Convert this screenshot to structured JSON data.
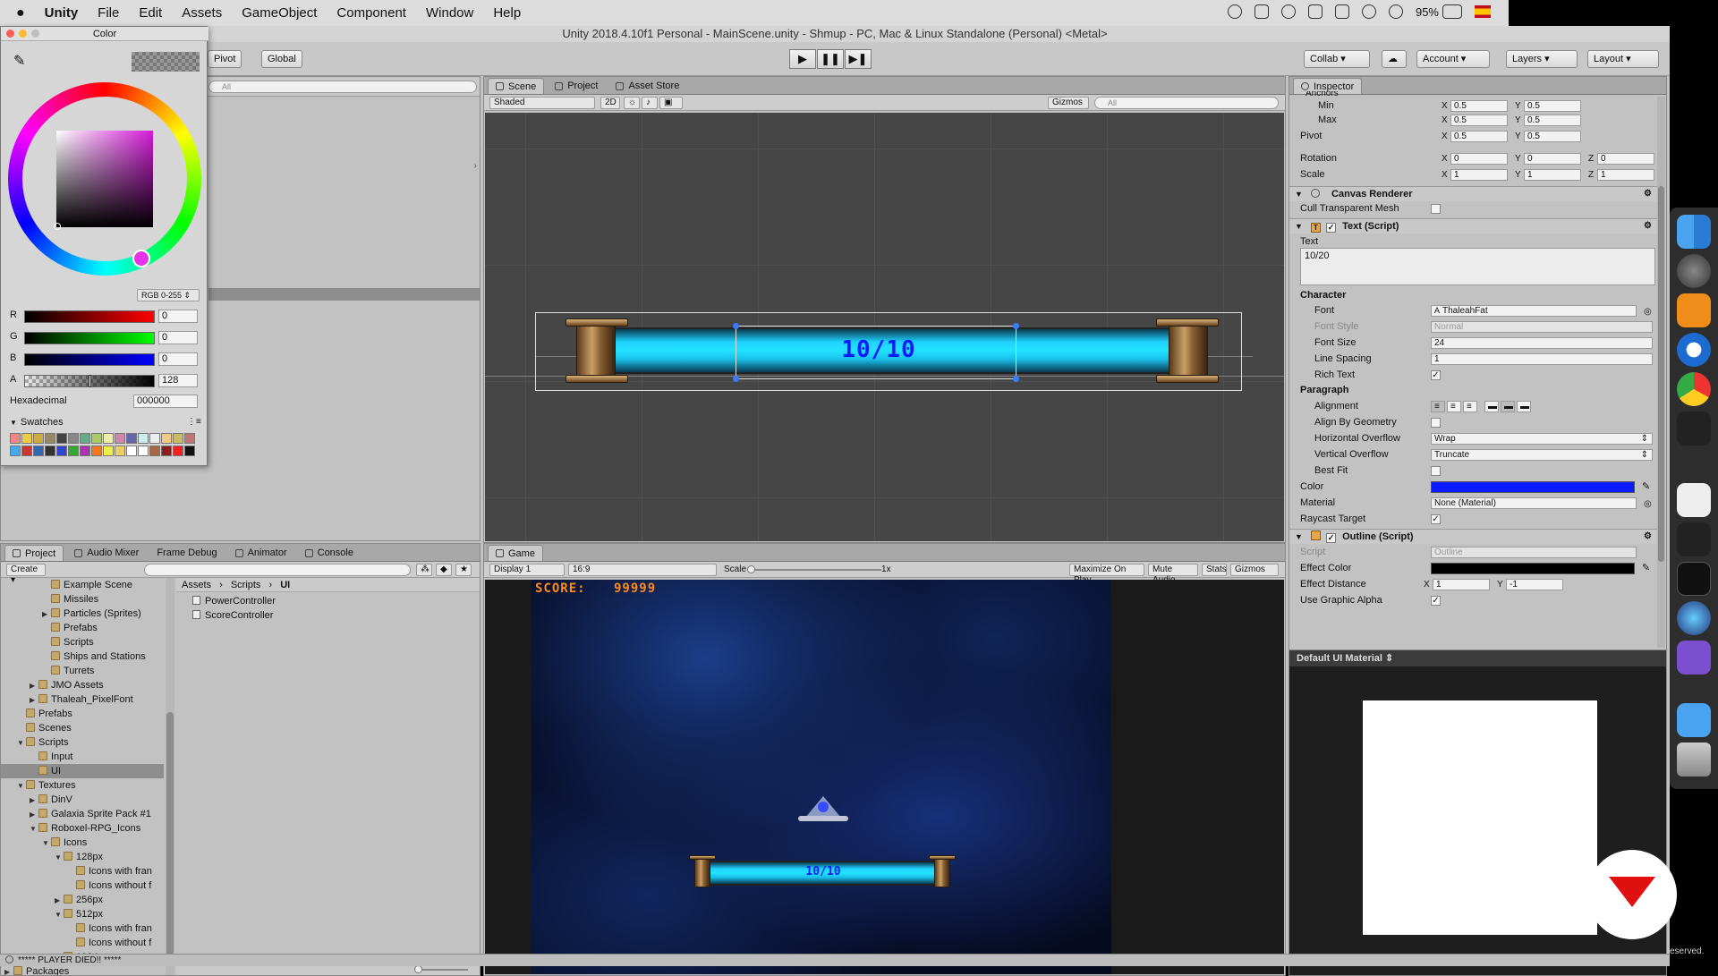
{
  "menubar": {
    "app": "Unity",
    "items": [
      "File",
      "Edit",
      "Assets",
      "GameObject",
      "Component",
      "Window",
      "Help"
    ],
    "battery": "95%"
  },
  "window_title": "Unity 2018.4.10f1 Personal - MainScene.unity - Shmup - PC, Mac & Linux Standalone (Personal) <Metal>",
  "toolbar": {
    "pivot": "Pivot",
    "global": "Global",
    "collab": "Collab",
    "account": "Account",
    "layers": "Layers",
    "layout": "Layout",
    "play": "▶",
    "pause": "❚❚",
    "step": "▶❚"
  },
  "color_picker": {
    "title": "Color",
    "mode": "RGB 0-255",
    "r_label": "R",
    "r": "0",
    "g_label": "G",
    "g": "0",
    "b_label": "B",
    "b": "0",
    "a_label": "A",
    "a": "128",
    "hex_label": "Hexadecimal",
    "hex": "000000",
    "swatches_label": "Swatches",
    "swatches": [
      "#e88",
      "#ec4",
      "#ca4",
      "#986",
      "#444",
      "#888",
      "#6a8",
      "#ac6",
      "#eea",
      "#c8a",
      "#66a",
      "#cee",
      "#eee",
      "#ec8",
      "#cb6",
      "#b77",
      "#4ae",
      "#c33",
      "#36a",
      "#333",
      "#34c",
      "#3a3",
      "#a3a",
      "#e72",
      "#ee4",
      "#ec6",
      "#fff",
      "#fff",
      "#a64",
      "#822",
      "#e22",
      "#111"
    ]
  },
  "hierarchy": {
    "search_placeholder": "All"
  },
  "scene": {
    "tabs": [
      "Scene",
      "Project",
      "Asset Store"
    ],
    "shading": "Shaded",
    "mode2d": "2D",
    "gizmos": "Gizmos",
    "search_placeholder": "All",
    "bar_text": "10/10"
  },
  "project": {
    "tabs": [
      "Project",
      "Audio Mixer",
      "Frame Debug",
      "Animator",
      "Console"
    ],
    "create": "Create",
    "tree": [
      {
        "label": "Example Scene",
        "indent": 3,
        "arrow": ""
      },
      {
        "label": "Missiles",
        "indent": 3,
        "arrow": ""
      },
      {
        "label": "Particles (Sprites)",
        "indent": 3,
        "arrow": "▶"
      },
      {
        "label": "Prefabs",
        "indent": 3,
        "arrow": ""
      },
      {
        "label": "Scripts",
        "indent": 3,
        "arrow": ""
      },
      {
        "label": "Ships and Stations",
        "indent": 3,
        "arrow": ""
      },
      {
        "label": "Turrets",
        "indent": 3,
        "arrow": ""
      },
      {
        "label": "JMO Assets",
        "indent": 2,
        "arrow": "▶"
      },
      {
        "label": "Thaleah_PixelFont",
        "indent": 2,
        "arrow": "▶"
      },
      {
        "label": "Prefabs",
        "indent": 1,
        "arrow": ""
      },
      {
        "label": "Scenes",
        "indent": 1,
        "arrow": ""
      },
      {
        "label": "Scripts",
        "indent": 1,
        "arrow": "▼"
      },
      {
        "label": "Input",
        "indent": 2,
        "arrow": ""
      },
      {
        "label": "UI",
        "indent": 2,
        "arrow": "",
        "selected": true
      },
      {
        "label": "Textures",
        "indent": 1,
        "arrow": "▼"
      },
      {
        "label": "DinV",
        "indent": 2,
        "arrow": "▶"
      },
      {
        "label": "Galaxia Sprite Pack #1",
        "indent": 2,
        "arrow": "▶"
      },
      {
        "label": "Roboxel-RPG_Icons",
        "indent": 2,
        "arrow": "▼"
      },
      {
        "label": "Icons",
        "indent": 3,
        "arrow": "▼"
      },
      {
        "label": "128px",
        "indent": 4,
        "arrow": "▼"
      },
      {
        "label": "Icons with fran",
        "indent": 5,
        "arrow": ""
      },
      {
        "label": "Icons without f",
        "indent": 5,
        "arrow": ""
      },
      {
        "label": "256px",
        "indent": 4,
        "arrow": "▶"
      },
      {
        "label": "512px",
        "indent": 4,
        "arrow": "▼"
      },
      {
        "label": "Icons with fran",
        "indent": 5,
        "arrow": ""
      },
      {
        "label": "Icons without f",
        "indent": 5,
        "arrow": ""
      },
      {
        "label": "1024px",
        "indent": 4,
        "arrow": "▶"
      },
      {
        "label": "Packages",
        "indent": 0,
        "arrow": "▶"
      }
    ],
    "breadcrumb": [
      "Assets",
      "Scripts",
      "UI"
    ],
    "files": [
      "PowerController",
      "ScoreController"
    ]
  },
  "game": {
    "tab": "Game",
    "display": "Display 1",
    "aspect": "16:9",
    "scale_label": "Scale",
    "scale_value": "1x",
    "maximize": "Maximize On Play",
    "mute": "Mute Audio",
    "stats": "Stats",
    "gizmos": "Gizmos",
    "score_label": "SCORE:",
    "score_value": "99999",
    "bar_text": "10/10"
  },
  "inspector": {
    "tab": "Inspector",
    "anchors_label": "Anchors",
    "min_label": "Min",
    "min_x": "0.5",
    "min_y": "0.5",
    "max_label": "Max",
    "max_x": "0.5",
    "max_y": "0.5",
    "pivot_label": "Pivot",
    "pivot_x": "0.5",
    "pivot_y": "0.5",
    "rotation_label": "Rotation",
    "rot_x": "0",
    "rot_y": "0",
    "rot_z": "0",
    "scale_label": "Scale",
    "scale_x": "1",
    "scale_y": "1",
    "scale_z": "1",
    "x": "X",
    "y": "Y",
    "z": "Z",
    "canvas_renderer": "Canvas Renderer",
    "cull_label": "Cull Transparent Mesh",
    "text_script": "Text (Script)",
    "text_label": "Text",
    "text_value": "10/20",
    "character_label": "Character",
    "font_label": "Font",
    "font_value": "ThaleahFat",
    "fontstyle_label": "Font Style",
    "fontstyle_value": "Normal",
    "fontsize_label": "Font Size",
    "fontsize_value": "24",
    "linespacing_label": "Line Spacing",
    "linespacing_value": "1",
    "richtext_label": "Rich Text",
    "paragraph_label": "Paragraph",
    "alignment_label": "Alignment",
    "alignbygeo_label": "Align By Geometry",
    "hoverflow_label": "Horizontal Overflow",
    "hoverflow_value": "Wrap",
    "voverflow_label": "Vertical Overflow",
    "voverflow_value": "Truncate",
    "bestfit_label": "Best Fit",
    "color_label": "Color",
    "color_value": "#0a1cff",
    "material_label": "Material",
    "material_value": "None (Material)",
    "raycast_label": "Raycast Target",
    "outline_script": "Outline (Script)",
    "script_label": "Script",
    "script_value": "Outline",
    "effectcolor_label": "Effect Color",
    "effectdist_label": "Effect Distance",
    "effectdist_x": "1",
    "effectdist_y": "-1",
    "usegraphicalpha_label": "Use Graphic Alpha",
    "default_material": "Default UI Material"
  },
  "statusbar": {
    "message": "***** PLAYER DIED!! *****"
  },
  "corner_text": "eserved."
}
